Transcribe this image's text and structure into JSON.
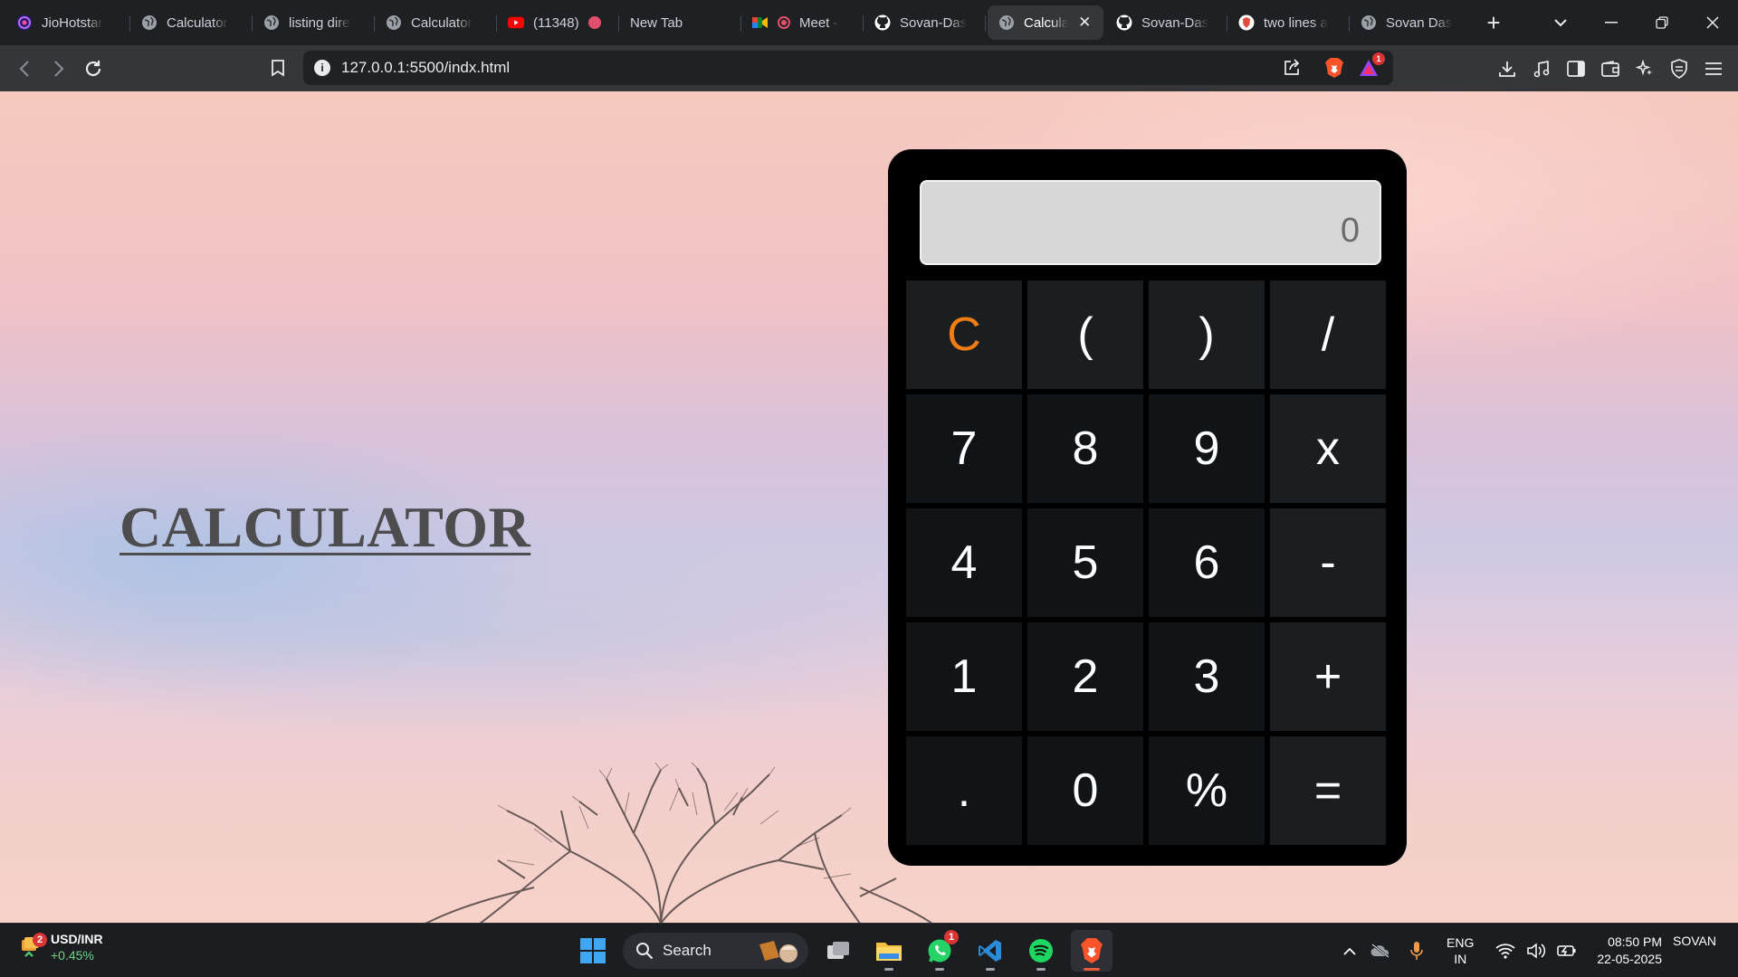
{
  "browser": {
    "tabs": [
      {
        "title": "JioHotstar",
        "icon": "jiohotstar-icon"
      },
      {
        "title": "Calculator",
        "icon": "globe-icon"
      },
      {
        "title": "listing dire",
        "icon": "globe-icon"
      },
      {
        "title": "Calculator",
        "icon": "globe-icon"
      },
      {
        "title": "(11348)",
        "icon": "youtube-icon"
      },
      {
        "title": "New Tab",
        "icon": ""
      },
      {
        "title": "Meet -",
        "icon": "google-meet-icon"
      },
      {
        "title": "Sovan-Das",
        "icon": "github-icon"
      },
      {
        "title": "Calcula",
        "icon": "globe-icon",
        "active": true
      },
      {
        "title": "Sovan-Das",
        "icon": "github-icon"
      },
      {
        "title": "two lines a",
        "icon": "brave-icon"
      },
      {
        "title": "Sovan Das",
        "icon": "globe-icon"
      }
    ],
    "close_glyph": "✕",
    "new_tab_glyph": "+",
    "url": "127.0.0.1:5500/indx.html",
    "notification_count": "1",
    "accent": "#fb542b"
  },
  "page": {
    "title": "CALCULATOR"
  },
  "calculator": {
    "display": "0",
    "keys": [
      "C",
      "(",
      ")",
      "/",
      "7",
      "8",
      "9",
      "x",
      "4",
      "5",
      "6",
      "-",
      "1",
      "2",
      "3",
      "+",
      ".",
      "0",
      "%",
      "="
    ],
    "clear_color": "#f07c13"
  },
  "taskbar": {
    "widget": {
      "title": "USD/INR",
      "change": "+0.45%",
      "badge": "2"
    },
    "search_placeholder": "Search",
    "whatsapp_badge": "1",
    "lang_top": "ENG",
    "lang_bottom": "IN",
    "time": "08:50 PM",
    "date": "22-05-2025",
    "user": "SOVAN"
  }
}
